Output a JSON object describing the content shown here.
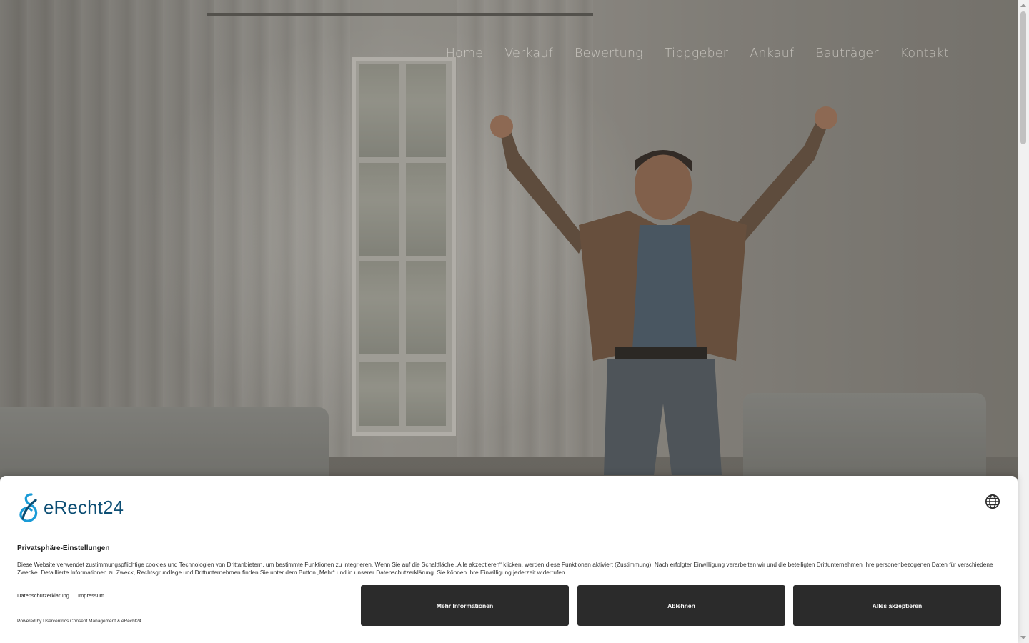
{
  "nav": {
    "items": [
      {
        "label": "Home"
      },
      {
        "label": "Verkauf"
      },
      {
        "label": "Bewertung"
      },
      {
        "label": "Tippgeber"
      },
      {
        "label": "Ankauf"
      },
      {
        "label": "Bauträger"
      },
      {
        "label": "Kontakt"
      }
    ]
  },
  "consent": {
    "logo_text": "eRecht24",
    "logo_color": "#0d4e74",
    "title": "Privatsphäre-Einstellungen",
    "body": "Diese Website verwendet zustimmungspflichtige cookies und Technologien von Drittanbietern, um bestimmte Funktionen zu integrieren. Wenn Sie auf die Schaltfläche „Alle akzeptieren“ klicken, werden diese Funktionen aktiviert (Zustimmung). Nach erfolgter Einwilligung verarbeiten wir und die beteiligten Drittunternehmen Ihre personenbezogenen Daten für verschiedene Zwecke. Detaillierte Informationen zu Zweck, Rechtsgrundlage und Drittunternehmen finden Sie unter dem Button „Mehr“ und in unserer Datenschutzerklärung. Sie können Ihre Einwilligung jederzeit widerrufen.",
    "links": {
      "privacy": "Datenschutzerklärung",
      "imprint": "Impressum"
    },
    "powered_by": "Powered by Usercentrics Consent Management & eRecht24",
    "buttons": {
      "more": "Mehr Informationen",
      "deny": "Ablehnen",
      "accept": "Alles akzeptieren"
    },
    "button_color": "#2b2b2b",
    "language_icon": "globe-icon"
  }
}
